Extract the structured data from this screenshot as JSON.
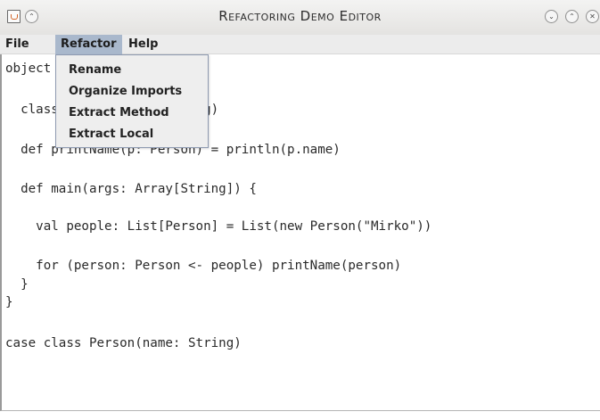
{
  "window": {
    "title": "Refactoring Demo Editor",
    "icons": [
      "java-app-icon",
      "chevron-up-double-icon",
      "minimize-icon",
      "maximize-icon",
      "close-icon"
    ]
  },
  "menubar": {
    "items": [
      {
        "label": "File"
      },
      {
        "label": "Refactor"
      },
      {
        "label": "Help"
      }
    ]
  },
  "refactor_menu": {
    "items": [
      {
        "label": "Rename"
      },
      {
        "label": "Organize Imports"
      },
      {
        "label": "Extract Method"
      },
      {
        "label": "Extract Local"
      }
    ]
  },
  "editor": {
    "lines": [
      "object Demo {",
      "",
      "  class Person(name: String)",
      "",
      "  def printName(p: Person) = println(p.name)",
      "",
      "  def main(args: Array[String]) {",
      "",
      "    val people: List[Person] = List(new Person(\"Mirko\"))",
      "",
      "    for (person: Person <- people) printName(person)",
      "  }",
      "}",
      "",
      "case class Person(name: String)"
    ]
  }
}
